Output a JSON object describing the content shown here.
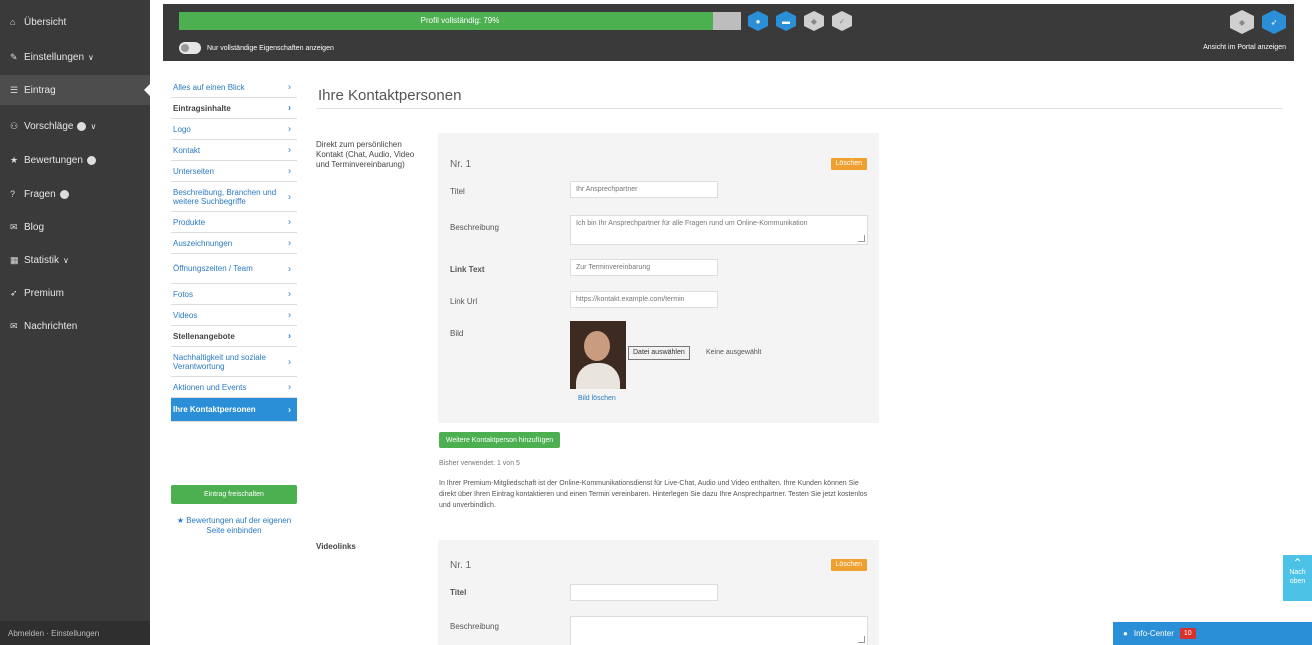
{
  "sidebar": {
    "items": [
      {
        "label": "Übersicht",
        "icon": "home-icon",
        "glyph": "⌂",
        "chev": false,
        "dot": false,
        "active": false
      },
      {
        "label": "Einstellungen",
        "icon": "wrench-icon",
        "glyph": "✎",
        "chev": true,
        "dot": false,
        "active": false
      },
      {
        "label": "Eintrag",
        "icon": "list-icon",
        "glyph": "☰",
        "chev": false,
        "dot": false,
        "active": true
      },
      {
        "label": "Vorschläge",
        "icon": "people-icon",
        "glyph": "⚇",
        "chev": true,
        "dot": true,
        "active": false
      },
      {
        "label": "Bewertungen",
        "icon": "star-icon",
        "glyph": "★",
        "chev": false,
        "dot": true,
        "active": false
      },
      {
        "label": "Fragen",
        "icon": "question-icon",
        "glyph": "?",
        "chev": false,
        "dot": true,
        "active": false
      },
      {
        "label": "Blog",
        "icon": "blog-icon",
        "glyph": "✉",
        "chev": false,
        "dot": false,
        "active": false
      },
      {
        "label": "Statistik",
        "icon": "chart-icon",
        "glyph": "▦",
        "chev": true,
        "dot": false,
        "active": false
      },
      {
        "label": "Premium",
        "icon": "rocket-icon",
        "glyph": "➶",
        "chev": false,
        "dot": false,
        "active": false
      },
      {
        "label": "Nachrichten",
        "icon": "mail-icon",
        "glyph": "✉",
        "chev": false,
        "dot": false,
        "active": false
      }
    ],
    "footer": "Abmelden · Einstellungen"
  },
  "topbar": {
    "progress_label": "Profil vollständig: 79%",
    "progress_percent": 95,
    "toggle_label": "Nur vollständige Eigenschaften anzeigen",
    "hex_icons": [
      "badge-icon",
      "chat-icon",
      "shield-icon",
      "check-icon"
    ],
    "hex_colors": [
      "blue",
      "blue",
      "grey",
      "grey"
    ],
    "right_icons": [
      "user-icon",
      "rocket-icon"
    ],
    "portal_link": "Ansicht im Portal anzeigen"
  },
  "subnav": {
    "items": [
      {
        "label": "Alles auf einen Blick",
        "style": "link",
        "tall": false
      },
      {
        "label": "Eintragsinhalte",
        "style": "dark",
        "tall": false
      },
      {
        "label": "Logo",
        "style": "link",
        "tall": false
      },
      {
        "label": "Kontakt",
        "style": "link",
        "tall": false
      },
      {
        "label": "Unterseiten",
        "style": "link",
        "tall": false
      },
      {
        "label": "Beschreibung, Branchen und weitere Suchbegriffe",
        "style": "link",
        "tall": true
      },
      {
        "label": "Produkte",
        "style": "link",
        "tall": false
      },
      {
        "label": "Auszeichnungen",
        "style": "link",
        "tall": false
      },
      {
        "label": "Öffnungszeiten / Team",
        "style": "link",
        "tall": true
      },
      {
        "label": "Fotos",
        "style": "link",
        "tall": false
      },
      {
        "label": "Videos",
        "style": "link",
        "tall": false
      },
      {
        "label": "Stellenangebote",
        "style": "dark",
        "tall": false
      },
      {
        "label": "Nachhaltigkeit und soziale Verantwortung",
        "style": "link",
        "tall": true
      },
      {
        "label": "Aktionen und Events",
        "style": "link",
        "tall": false
      },
      {
        "label": "Ihre Kontaktpersonen",
        "style": "active",
        "tall": false
      }
    ],
    "release_button": "Eintrag freischalten",
    "rating_link": "★ Bewertungen auf der eigenen Seite einbinden"
  },
  "main": {
    "title": "Ihre Kontaktpersonen",
    "direct_label": "Direkt zum persönlichen Kontakt (Chat, Audio, Video und Terminvereinbarung)",
    "card1": {
      "number": "Nr. 1",
      "delete": "Löschen",
      "fields": [
        {
          "label": "Titel",
          "value": "Ihr Ansprechpartner",
          "bold": false
        },
        {
          "label": "Beschreibung",
          "value": "Ich bin Ihr Ansprechpartner für alle Fragen rund um Online-Kommunikation",
          "bold": false
        },
        {
          "label": "Link Text",
          "value": "Zur Terminvereinbarung",
          "bold": true
        },
        {
          "label": "Link Url",
          "value": "https://kontakt.example.com/termin",
          "bold": false
        },
        {
          "label": "Bild",
          "value": "",
          "bold": false
        }
      ],
      "file_button": "Datei auswählen",
      "file_none": "Keine ausgewählt",
      "image_delete": "Bild löschen"
    },
    "add_contact_button": "Weitere Kontaktperson hinzufügen",
    "usage": "Bisher verwendet: 1 von 5",
    "premium_text": "In Ihrer Premium-Mitgliedschaft ist der Online-Kommunikationsdienst für Live-Chat, Audio und Video enthalten. Ihre Kunden können Sie direkt über Ihren Eintrag kontaktieren und einen Termin vereinbaren. Hinterlegen Sie dazu Ihre Ansprechpartner. Testen Sie jetzt kostenlos und unverbindlich.",
    "video_label": "Videolinks",
    "card2": {
      "number": "Nr. 1",
      "delete": "Löschen",
      "title_label": "Titel",
      "desc_label": "Beschreibung"
    }
  },
  "floating": {
    "top_button": "Nach oben",
    "info_center": "Info-Center",
    "info_count": "10"
  }
}
